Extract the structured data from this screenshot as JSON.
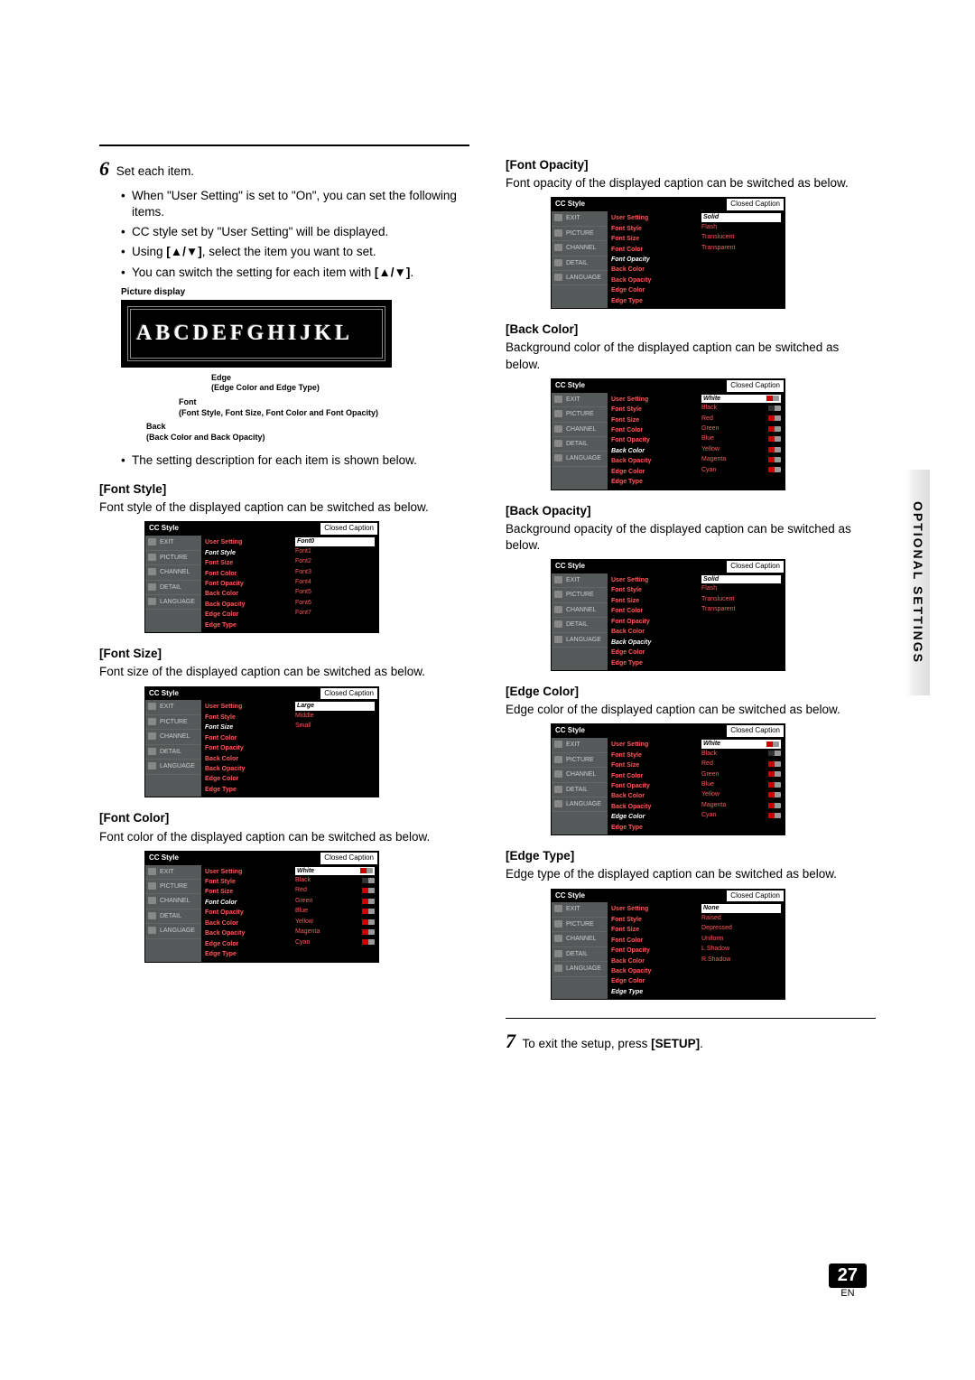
{
  "sidetab": "OPTIONAL SETTINGS",
  "page_number": "27",
  "page_lang": "EN",
  "step6": {
    "num": "6",
    "title": "Set each item.",
    "bullets": [
      "When \"User Setting\" is set to \"On\", you can set the following items.",
      "CC style set by \"User Setting\" will be displayed.",
      "Using [▲/▼], select the item you want to set.",
      "You can switch the setting for each item with [▲/▼]."
    ],
    "pic_display_label": "Picture display",
    "pic_display_text": "ABCDEFGHIJKL",
    "labels": {
      "edge": "Edge",
      "edge_sub": "(Edge Color and Edge Type)",
      "font": "Font",
      "font_sub": "(Font Style, Font Size, Font Color and Font Opacity)",
      "back": "Back",
      "back_sub": "(Back Color and Back Opacity)"
    },
    "note": "The setting description for each item is shown below."
  },
  "osd_common": {
    "title": "CC Style",
    "badge": "Closed Caption",
    "left_tabs": [
      "EXIT",
      "PICTURE",
      "CHANNEL",
      "DETAIL",
      "LANGUAGE"
    ],
    "mid_items": [
      "User Setting",
      "Font Style",
      "Font Size",
      "Font Color",
      "Font Opacity",
      "Back Color",
      "Back Opacity",
      "Edge Color",
      "Edge Type"
    ]
  },
  "sections": [
    {
      "head": "[Font Style]",
      "desc": "Font style of the displayed caption can be switched as below.",
      "highlight": "Font Style",
      "options": [
        "Font0",
        "Font1",
        "Font2",
        "Font3",
        "Font4",
        "Font5",
        "Font6",
        "Font7"
      ],
      "swatches": false
    },
    {
      "head": "[Font Size]",
      "desc": "Font size of the displayed caption can be switched as below.",
      "highlight": "Font Size",
      "options": [
        "Large",
        "Middle",
        "Small"
      ],
      "swatches": false
    },
    {
      "head": "[Font Color]",
      "desc": "Font color of the displayed caption can be switched as below.",
      "highlight": "Font Color",
      "options": [
        "White",
        "Black",
        "Red",
        "Green",
        "Blue",
        "Yellow",
        "Magenta",
        "Cyan"
      ],
      "swatches": true
    },
    {
      "head": "[Font Opacity]",
      "desc": "Font opacity of the displayed caption can be switched as below.",
      "highlight": "Font Opacity",
      "options": [
        "Solid",
        "Flash",
        "Translucent",
        "Transparent"
      ],
      "swatches": false
    },
    {
      "head": "[Back Color]",
      "desc": "Background color of the displayed caption can be switched as below.",
      "highlight": "Back Color",
      "options": [
        "White",
        "Black",
        "Red",
        "Green",
        "Blue",
        "Yellow",
        "Magenta",
        "Cyan"
      ],
      "swatches": true
    },
    {
      "head": "[Back Opacity]",
      "desc": "Background opacity of the displayed caption can be switched as below.",
      "highlight": "Back Opacity",
      "options": [
        "Solid",
        "Flash",
        "Translucent",
        "Transparent"
      ],
      "swatches": false
    },
    {
      "head": "[Edge Color]",
      "desc": "Edge color of the displayed caption can be switched as below.",
      "highlight": "Edge Color",
      "options": [
        "White",
        "Black",
        "Red",
        "Green",
        "Blue",
        "Yellow",
        "Magenta",
        "Cyan"
      ],
      "swatches": true
    },
    {
      "head": "[Edge Type]",
      "desc": "Edge type of the displayed caption can be switched as below.",
      "highlight": "Edge Type",
      "options": [
        "None",
        "Raised",
        "Depressed",
        "Uniform",
        "L.Shadow",
        "R.Shadow"
      ],
      "swatches": false
    }
  ],
  "step7": {
    "num": "7",
    "text_a": "To exit the setup, press ",
    "text_b": "[SETUP]",
    "text_c": "."
  }
}
